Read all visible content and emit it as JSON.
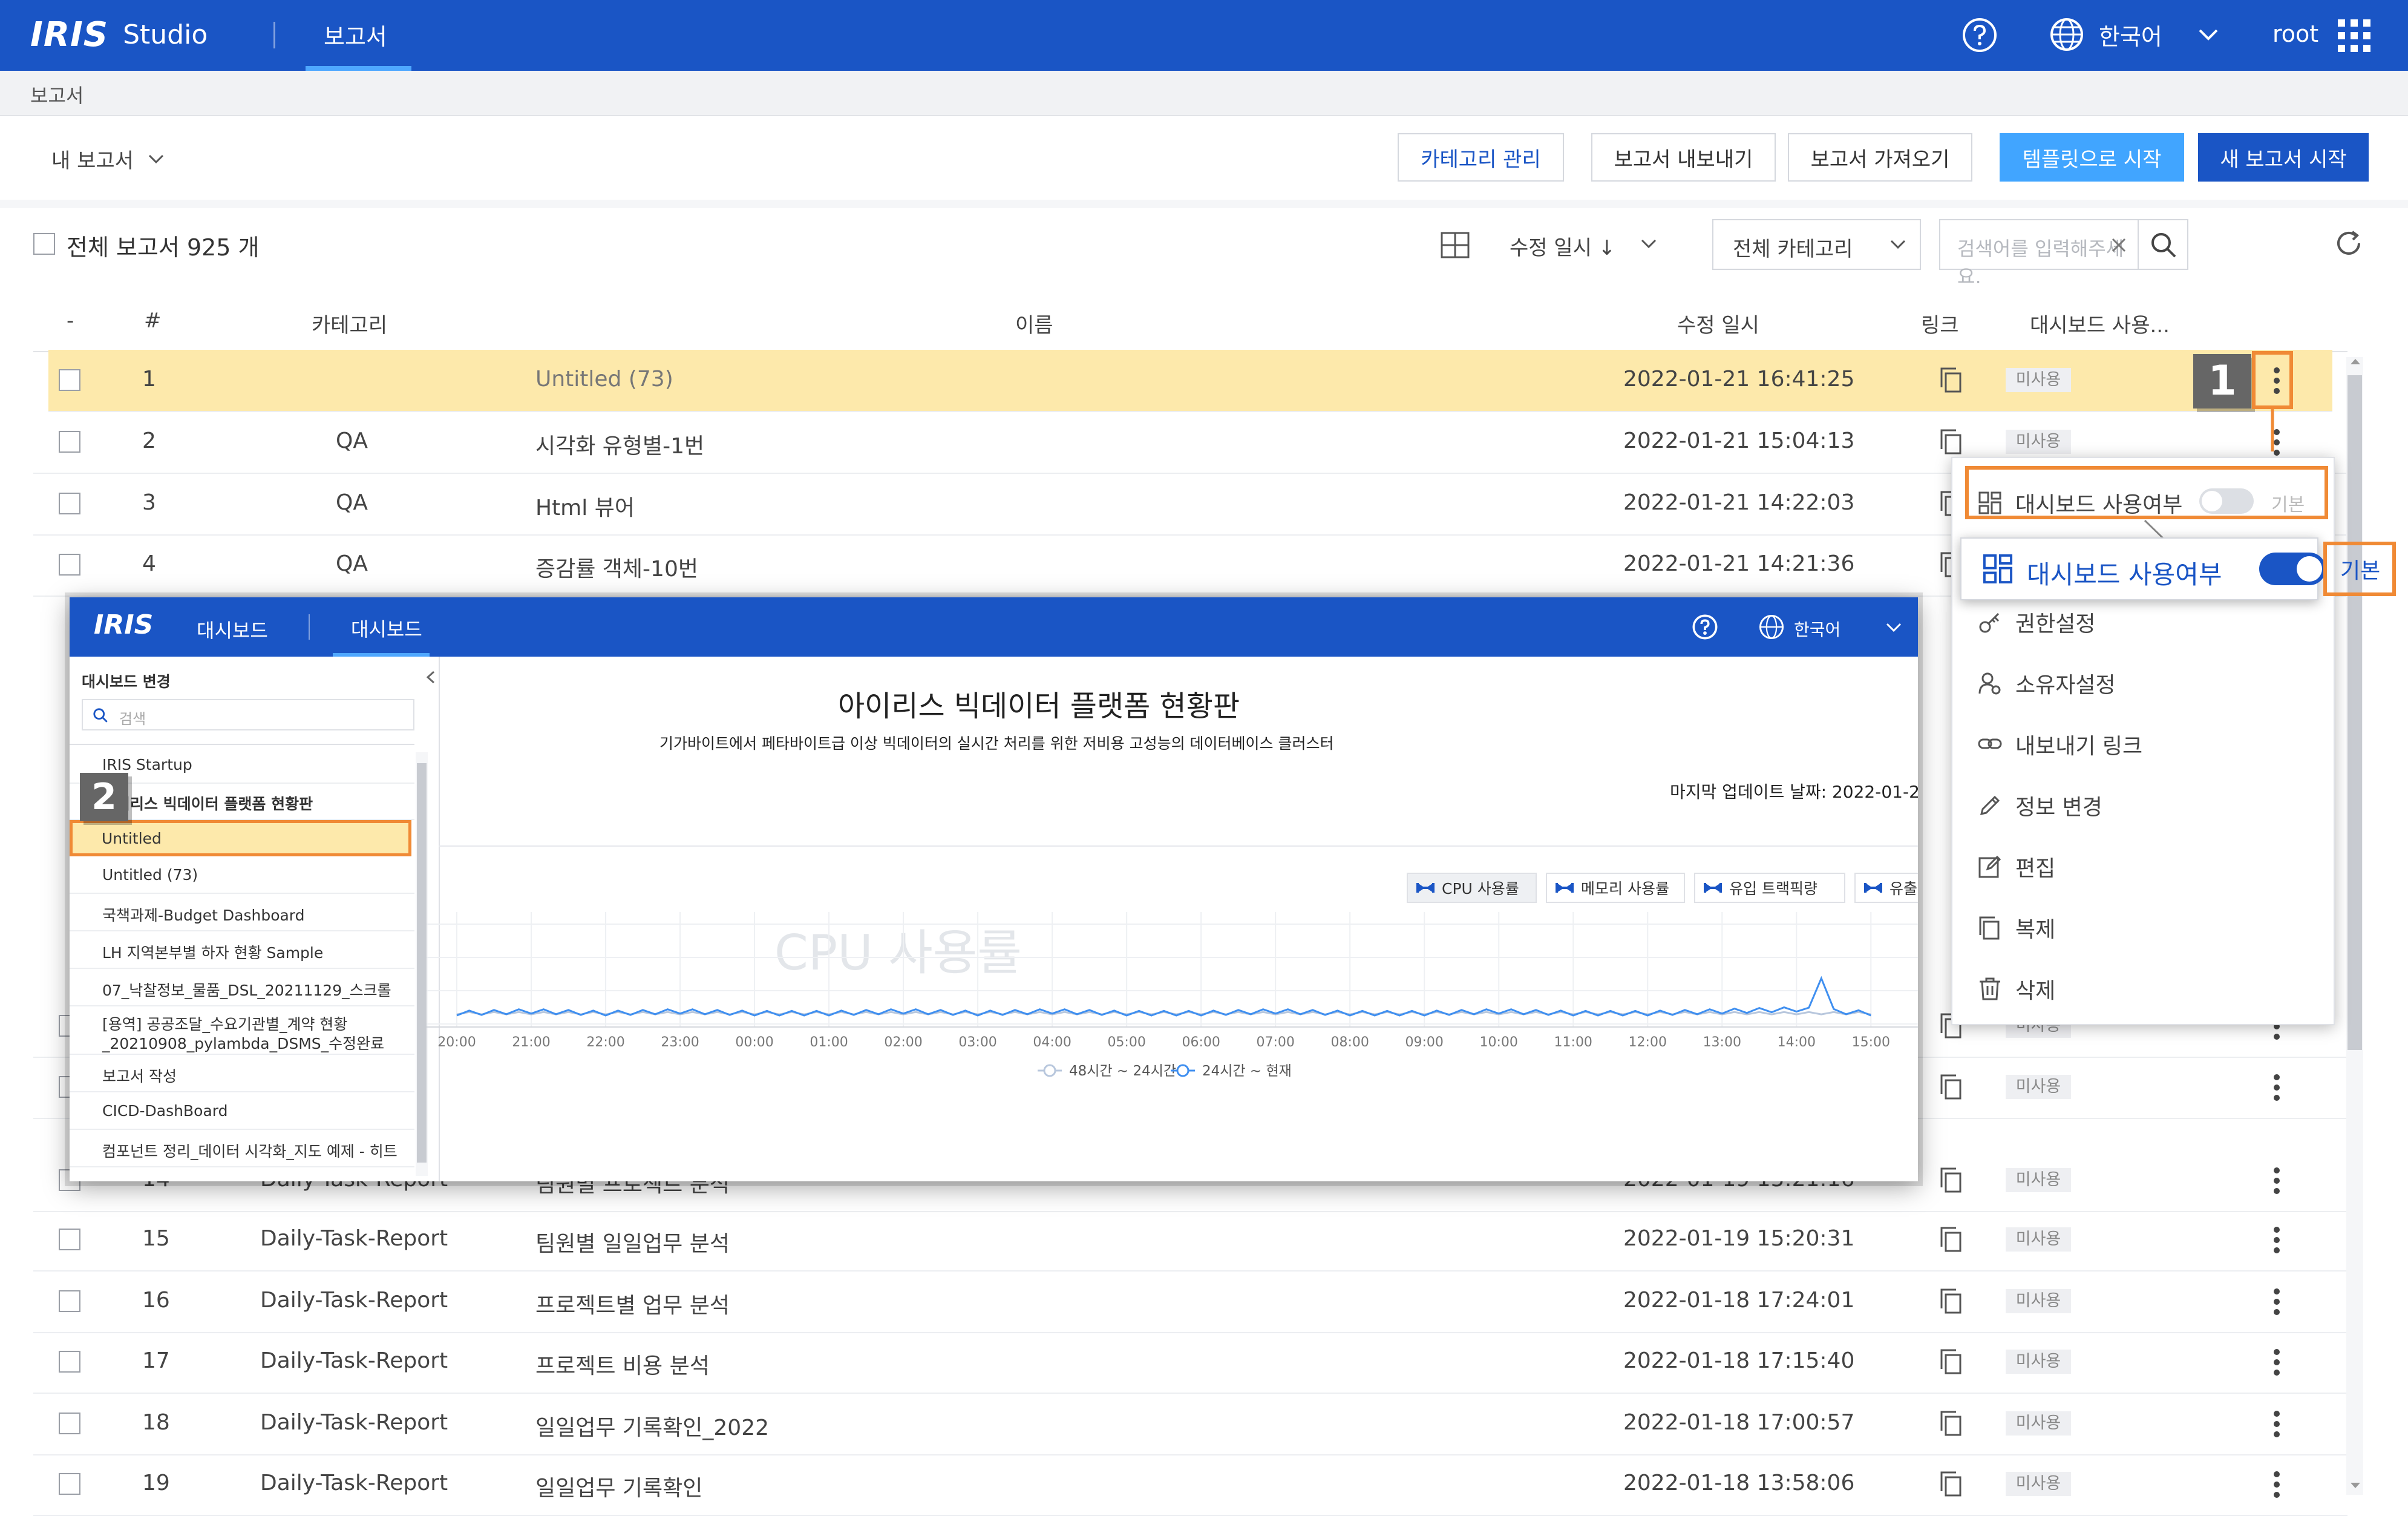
{
  "app": {
    "brand": "IRIS",
    "product": "Studio",
    "active_tab": "보고서",
    "language": "한국어",
    "user": "root"
  },
  "breadcrumb": "보고서",
  "toolbar": {
    "scope": "내 보고서",
    "buttons": [
      "카테고리 관리",
      "보고서 내보내기",
      "보고서 가져오기",
      "템플릿으로 시작",
      "새 보고서 시작"
    ]
  },
  "list": {
    "total": "전체 보고서 925 개",
    "sort": "수정 일시 ↓",
    "category_filter": "전체 카테고리",
    "search_placeholder": "검색어를 입력해주세요.",
    "columns": [
      "-",
      "#",
      "카테고리",
      "이름",
      "수정 일시",
      "링크",
      "대시보드 사용..."
    ],
    "rows": [
      {
        "num": "1",
        "category": "",
        "name": "Untitled (73)",
        "modified": "2022-01-21 16:41:25",
        "dashboard": "미사용"
      },
      {
        "num": "2",
        "category": "QA",
        "name": "시각화 유형별-1번",
        "modified": "2022-01-21 15:04:13",
        "dashboard": "미사용"
      },
      {
        "num": "3",
        "category": "QA",
        "name": "Html 뷰어",
        "modified": "2022-01-21 14:22:03",
        "dashboard": ""
      },
      {
        "num": "4",
        "category": "QA",
        "name": "증감률 객체-10번",
        "modified": "2022-01-21 14:21:36",
        "dashboard": ""
      },
      {
        "num": "",
        "category": "",
        "name": "",
        "modified": "",
        "dashboard": "미사용"
      },
      {
        "num": "",
        "category": "",
        "name": "",
        "modified": "",
        "dashboard": "미사용"
      },
      {
        "num": "14",
        "category": "Daily-Task-Report",
        "name": "팀원별 프로젝트 분석",
        "modified": "2022-01-19 15:21:16",
        "dashboard": "미사용"
      },
      {
        "num": "15",
        "category": "Daily-Task-Report",
        "name": "팀원별 일일업무 분석",
        "modified": "2022-01-19 15:20:31",
        "dashboard": "미사용"
      },
      {
        "num": "16",
        "category": "Daily-Task-Report",
        "name": "프로젝트별 업무 분석",
        "modified": "2022-01-18 17:24:01",
        "dashboard": "미사용"
      },
      {
        "num": "17",
        "category": "Daily-Task-Report",
        "name": "프로젝트 비용 분석",
        "modified": "2022-01-18 17:15:40",
        "dashboard": "미사용"
      },
      {
        "num": "18",
        "category": "Daily-Task-Report",
        "name": "일일업무 기록확인_2022",
        "modified": "2022-01-18 17:00:57",
        "dashboard": "미사용"
      },
      {
        "num": "19",
        "category": "Daily-Task-Report",
        "name": "일일업무 기록확인",
        "modified": "2022-01-18 13:58:06",
        "dashboard": "미사용"
      }
    ]
  },
  "callouts": {
    "first": "1",
    "second": "2"
  },
  "context_menu": {
    "dashboard_toggle": "대시보드 사용여부",
    "default_label": "기본",
    "items": [
      "권한설정",
      "소유자설정",
      "내보내기 링크",
      "정보 변경",
      "편집",
      "복제",
      "삭제"
    ]
  },
  "dashboard": {
    "brand": "IRIS",
    "product": "대시보드",
    "tab": "대시보드",
    "language": "한국어",
    "side_title": "대시보드 변경",
    "search_placeholder": "검색",
    "side_items": [
      "IRIS Startup",
      "아이리스 빅데이터 플랫폼 현황판",
      "Untitled",
      "Untitled (73)",
      "국책과제-Budget Dashboard",
      "LH 지역본부별 하자 현황 Sample",
      "07_낙찰정보_물품_DSL_20211129_스크롤",
      "[용역] 공공조달_수요기관별_계약 현황",
      "_20210908_pylambda_DSMS_수정완료",
      "보고서 작성",
      "CICD-DashBoard",
      "컴포넌트 정리_데이터 시각화_지도 예제 - 히트"
    ],
    "title": "아이리스 빅데이터 플랫폼 현황판",
    "subtitle": "기가바이트에서 페타바이트급 이상 빅데이터의 실시간 처리를 위한 저비용 고성능의 데이터베이스 클러스터",
    "last_update": "마지막 업데이트 날짜: 2022-01-2",
    "chart_tabs": [
      "CPU 사용률",
      "메모리 사용률",
      "유입 트랙픽량",
      "유출"
    ],
    "watermark": "CPU 사용률"
  },
  "chart_data": {
    "type": "line",
    "title": "CPU 사용률",
    "x": [
      "20:00",
      "21:00",
      "22:00",
      "23:00",
      "00:00",
      "01:00",
      "02:00",
      "03:00",
      "04:00",
      "05:00",
      "06:00",
      "07:00",
      "08:00",
      "09:00",
      "10:00",
      "11:00",
      "12:00",
      "13:00",
      "14:00",
      "15:00"
    ],
    "series": [
      {
        "name": "48시간 ~ 24시간",
        "values": [
          4,
          4,
          4,
          4,
          4,
          4,
          4,
          4,
          4,
          4,
          4,
          4,
          4,
          4,
          4,
          4,
          4,
          4,
          4,
          4
        ]
      },
      {
        "name": "24시간 ~ 현재",
        "values": [
          4,
          5,
          4,
          5,
          4,
          4,
          5,
          4,
          5,
          4,
          4,
          5,
          4,
          4,
          5,
          4,
          4,
          5,
          6,
          4
        ]
      }
    ],
    "grid": true,
    "legend": "bottom-center"
  },
  "colors": {
    "brand_blue": "#1a55c5",
    "accent_light": "#41a5ff",
    "highlight": "#fde9ab",
    "callout": "#f08a35"
  }
}
